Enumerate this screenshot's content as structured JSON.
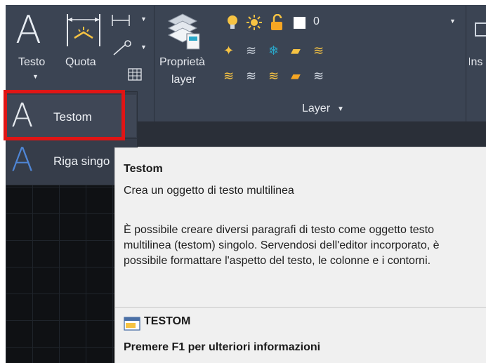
{
  "ribbon": {
    "testo_label": "Testo",
    "quota_label": "Quota",
    "proprieta_label": "Proprietà",
    "layer_label": "layer",
    "layer_panel_label": "Layer",
    "layer_current_value": "0",
    "partial_right_label": "Ins"
  },
  "dropdown": {
    "items": [
      {
        "label": "Testom"
      },
      {
        "label": "Riga singo"
      }
    ]
  },
  "tooltip": {
    "title": "Testom",
    "description": "Crea un oggetto di testo multilinea",
    "body": "È possibile creare diversi paragrafi di testo come oggetto testo multilinea (testom) singolo. Servendosi dell'editor incorporato, è possibile formattare l'aspetto del testo, le colonne e i contorni.",
    "command": "TESTOM",
    "help": "Premere F1 per ulteriori informazioni"
  },
  "colors": {
    "ribbon_bg": "#3b4453",
    "highlight": "#e01515",
    "tooltip_bg": "#f0f0f0",
    "bulb_yellow": "#f6c343",
    "layer_teal": "#2aa7c9"
  }
}
